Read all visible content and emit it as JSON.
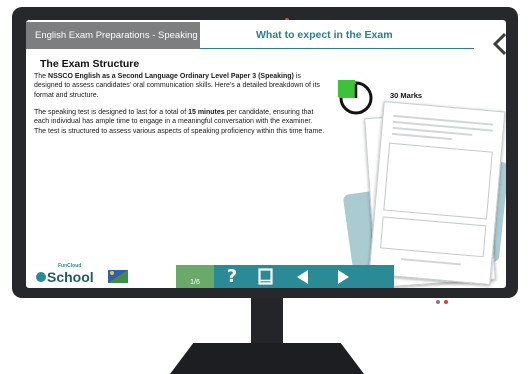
{
  "header": {
    "tab_title": "English Exam Preparations - Speaking",
    "page_heading": "What to expect in the Exam"
  },
  "content": {
    "section_title": "The Exam Structure",
    "p1": {
      "pre": "The ",
      "bold": "NSSCO English as a Second Language Ordinary Level Paper 3 (Speaking)",
      "post": " is designed to assess candidates' oral communication skills. Here's a detailed breakdown of its format and structure."
    },
    "p2": {
      "pre": "The speaking test is designed to last for a total of ",
      "bold": "15 minutes",
      "post": " per candidate, ensuring that each individual has ample time to engage in a meaningful conversation with the examiner. The test is structured to assess various aspects of speaking proficiency within this time frame."
    }
  },
  "side": {
    "marks_label": "30 Marks",
    "timer_fraction": 0.25
  },
  "footer": {
    "logo_text": "School",
    "logo_small": "FunCloud",
    "page_indicator": "1/6"
  },
  "colors": {
    "teal": "#2a8a96",
    "green": "#6aa96a",
    "monitor": "#26282b"
  },
  "icons": [
    "back-chevron-icon",
    "stopwatch-icon",
    "help-icon",
    "book-icon",
    "prev-arrow-icon",
    "next-arrow-icon"
  ]
}
